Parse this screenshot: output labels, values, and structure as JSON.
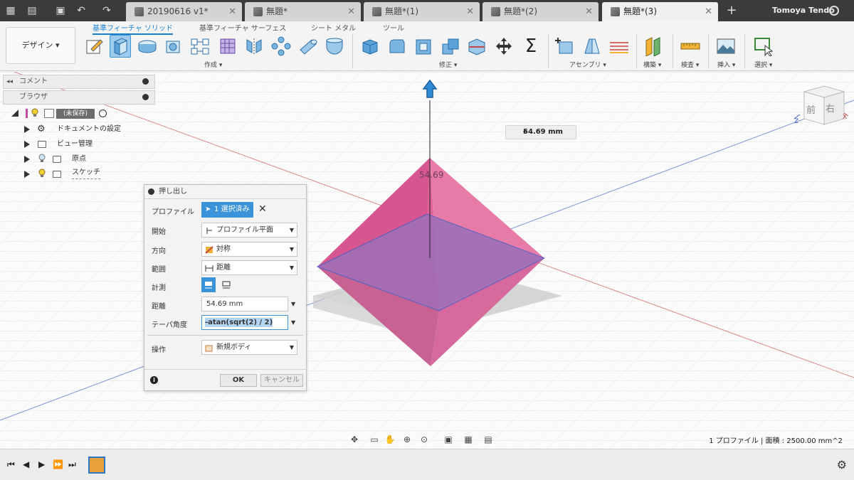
{
  "titlebar": {
    "tabs": [
      {
        "label": "20190616 v1*",
        "active": false
      },
      {
        "label": "無題*",
        "active": false
      },
      {
        "label": "無題*(1)",
        "active": false
      },
      {
        "label": "無題*(2)",
        "active": false
      },
      {
        "label": "無題*(3)",
        "active": true
      }
    ],
    "close_glyph": "✕",
    "add_glyph": "+",
    "user": "Tomoya Tendo"
  },
  "ribbon": {
    "workspace": "デザイン ▾",
    "tabs": [
      {
        "label": "基準フィーチャ ソリッド",
        "active": true
      },
      {
        "label": "基準フィーチャ サーフェス",
        "active": false
      },
      {
        "label": "シート メタル",
        "active": false
      },
      {
        "label": "ツール",
        "active": false
      }
    ],
    "groups": {
      "create": "作成 ▾",
      "modify": "修正 ▾",
      "assemble": "アセンブリ ▾",
      "construct": "構築 ▾",
      "inspect": "検査 ▾",
      "insert": "挿入 ▾",
      "select": "選択 ▾"
    },
    "sigma": "Σ"
  },
  "browser": {
    "comments_label": "コメント",
    "browser_label": "ブラウザ",
    "root_label": "(未保存)",
    "items": [
      {
        "label": "ドキュメントの設定"
      },
      {
        "label": "ビュー管理"
      },
      {
        "label": "原点"
      },
      {
        "label": "スケッチ"
      }
    ]
  },
  "viewport": {
    "dimension_value": "54.69 mm",
    "dimension_label": "54.69",
    "viewcube": {
      "front": "前",
      "right": "右"
    },
    "axis_x": "X",
    "axis_z": "Z",
    "status": "1 プロファイル | 面積 : 2500.00 mm^2"
  },
  "dialog": {
    "title": "押し出し",
    "rows": {
      "profile": {
        "label": "プロファイル",
        "value": "1 選択済み"
      },
      "start": {
        "label": "開始",
        "value": "プロファイル平面"
      },
      "direction": {
        "label": "方向",
        "value": "対称"
      },
      "extent": {
        "label": "範囲",
        "value": "距離"
      },
      "measure": {
        "label": "計測"
      },
      "distance": {
        "label": "距離",
        "value": "54.69 mm"
      },
      "taper": {
        "label": "テーパ角度",
        "value": "-atan(sqrt(2) / 2)"
      },
      "operation": {
        "label": "操作",
        "value": "新規ボディ"
      }
    },
    "ok": "OK",
    "cancel": "キャンセル",
    "info_glyph": "i"
  },
  "colors": {
    "accent": "#3b93da",
    "solid_top": "#e2588f",
    "solid_profile": "#9b6fb9"
  }
}
